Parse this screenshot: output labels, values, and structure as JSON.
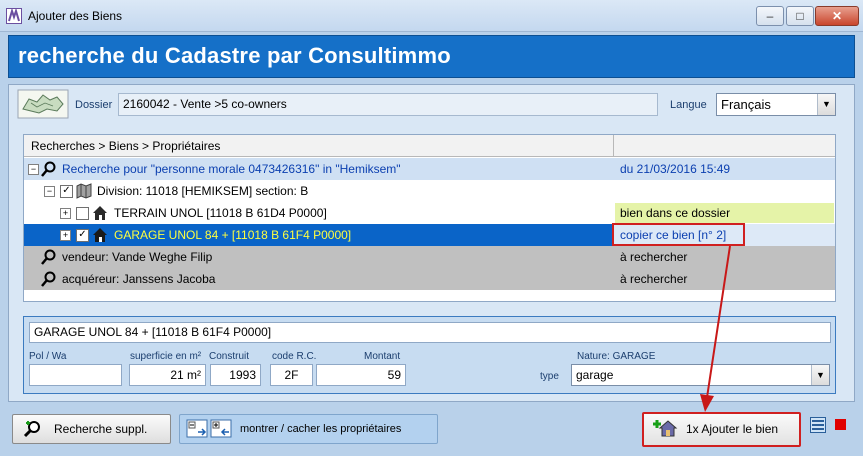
{
  "window": {
    "title": "Ajouter des Biens"
  },
  "banner": {
    "title": "recherche du Cadastre par Consultimmo"
  },
  "dossier": {
    "label": "Dossier",
    "value": "2160042 - Vente >5 co-owners"
  },
  "langue": {
    "label": "Langue",
    "value": "Français"
  },
  "tree": {
    "header": "Recherches > Biens > Propriétaires",
    "rows": [
      {
        "text": "Recherche pour \"personne morale 0473426316\" in \"Hemiksem\"",
        "right": "du 21/03/2016 15:49"
      },
      {
        "text": "Division: 11018 [HEMIKSEM]   section: B",
        "right": ""
      },
      {
        "text": "TERRAIN    UNOL      [11018 B 61D4 P0000]",
        "right": "bien dans ce dossier"
      },
      {
        "text": "GARAGE    UNOL 84 +      [11018 B 61F4 P0000]",
        "right": "copier ce bien [n° 2]"
      },
      {
        "text": "vendeur: Vande Weghe Filip",
        "right": "à rechercher"
      },
      {
        "text": "acquéreur: Janssens Jacoba",
        "right": "à rechercher"
      }
    ]
  },
  "detail": {
    "description": "GARAGE    UNOL 84 +      [11018 B 61F4 P0000]",
    "labels": {
      "pol": "Pol / Wa",
      "superficie": "superficie en m²",
      "construit": "Construit",
      "code_rc": "code R.C.",
      "montant": "Montant",
      "nature": "Nature: GARAGE",
      "type": "type"
    },
    "values": {
      "pol": "",
      "superficie": "21 m²",
      "construit": "1993",
      "code_rc": "2F",
      "montant": "59",
      "type": "garage"
    }
  },
  "toolbar": {
    "recherche": "Recherche suppl.",
    "montrer": "montrer / cacher les propriétaires",
    "ajouter": "1x Ajouter le bien"
  },
  "colors": {
    "accent": "#1570c8",
    "selection": "#0a64c8",
    "highlight_green": "#e5f3a8",
    "annotation_red": "#d02020"
  }
}
